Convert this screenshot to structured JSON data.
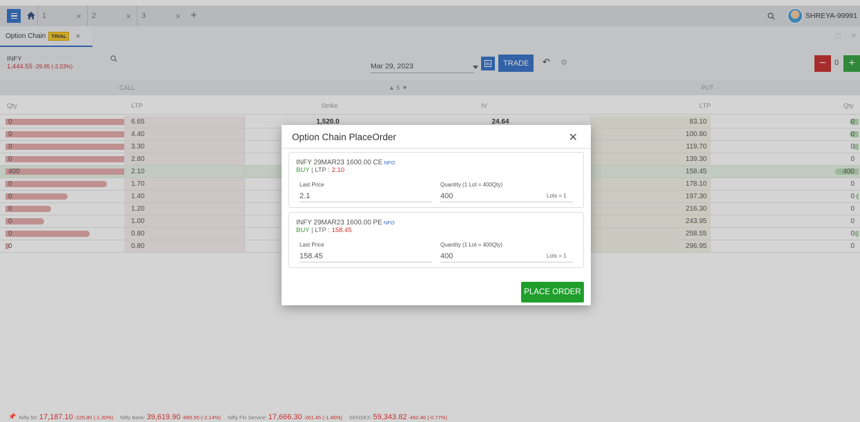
{
  "tabs": [
    {
      "label": "1"
    },
    {
      "label": "2"
    },
    {
      "label": "3"
    }
  ],
  "user": {
    "name": "SHREYA-99991"
  },
  "subtab": {
    "label": "Option Chain",
    "badge": "TRIAL"
  },
  "toolbar": {
    "symbol": "INFY",
    "price": "1,444.55",
    "change": "-29.95 (-2.03%)",
    "expiry": "Mar 29, 2023",
    "trade_label": "TRADE",
    "lots": "0"
  },
  "chain_header": {
    "call": "CALL",
    "put": "PUT",
    "strikes_count": "5"
  },
  "columns": {
    "qty": "Qty",
    "ltp": "LTP",
    "strike": "Strike",
    "iv": "IV",
    "put_ltp": "LTP",
    "put_qty": "Qty"
  },
  "rows": [
    {
      "call_qty": "0",
      "call_ltp": "6.65",
      "strike": "1,520.0",
      "iv": "24.64",
      "put_ltp": "83.10",
      "put_qty": "0",
      "call_bar": 0.94,
      "put_bar": 0.06
    },
    {
      "call_qty": "0",
      "call_ltp": "4.40",
      "strike": "",
      "iv": "",
      "put_ltp": "100.80",
      "put_qty": "0",
      "call_bar": 0.94,
      "put_bar": 0.06
    },
    {
      "call_qty": "0",
      "call_ltp": "3.30",
      "strike": "",
      "iv": "",
      "put_ltp": "119.70",
      "put_qty": "0",
      "call_bar": 0.73,
      "put_bar": 0.04
    },
    {
      "call_qty": "0",
      "call_ltp": "2.80",
      "strike": "",
      "iv": "",
      "put_ltp": "139.30",
      "put_qty": "0",
      "call_bar": 0.66,
      "put_bar": 0
    },
    {
      "call_qty": "400",
      "call_ltp": "2.10",
      "strike": "",
      "iv": "",
      "put_ltp": "158.45",
      "put_qty": "400",
      "call_bar": 1.0,
      "put_bar": 0.16,
      "atm": true
    },
    {
      "call_qty": "0",
      "call_ltp": "1.70",
      "strike": "",
      "iv": "",
      "put_ltp": "178.10",
      "put_qty": "0",
      "call_bar": 0.47,
      "put_bar": 0
    },
    {
      "call_qty": "0",
      "call_ltp": "1.40",
      "strike": "",
      "iv": "",
      "put_ltp": "197.30",
      "put_qty": "0",
      "call_bar": 0.29,
      "put_bar": 0.02
    },
    {
      "call_qty": "0",
      "call_ltp": "1.20",
      "strike": "",
      "iv": "",
      "put_ltp": "216.30",
      "put_qty": "0",
      "call_bar": 0.21,
      "put_bar": 0
    },
    {
      "call_qty": "0",
      "call_ltp": "1.00",
      "strike": "",
      "iv": "",
      "put_ltp": "243.95",
      "put_qty": "0",
      "call_bar": 0.18,
      "put_bar": 0
    },
    {
      "call_qty": "0",
      "call_ltp": "0.80",
      "strike": "",
      "iv": "",
      "put_ltp": "258.55",
      "put_qty": "0",
      "call_bar": 0.39,
      "put_bar": 0.03
    },
    {
      "call_qty": "0",
      "call_ltp": "0.80",
      "strike": "",
      "iv": "",
      "put_ltp": "296.95",
      "put_qty": "0",
      "call_bar": 0.02,
      "put_bar": 0
    }
  ],
  "modal": {
    "title": "Option Chain PlaceOrder",
    "legs": [
      {
        "symbol": "INFY 29MAR23 1600.00 CE",
        "exchange": "NFO",
        "side": "BUY",
        "ltp_label": "LTP :",
        "ltp": "2.10",
        "price_label": "Last Price",
        "price": "2.1",
        "qty_label": "Quantity (1 Lot = 400Qty)",
        "qty": "400",
        "lots": "Lots = 1"
      },
      {
        "symbol": "INFY 29MAR23 1600.00 PE",
        "exchange": "NFO",
        "side": "BUY",
        "ltp_label": "LTP :",
        "ltp": "158.45",
        "price_label": "Last Price",
        "price": "158.45",
        "qty_label": "Quantity (1 Lot = 400Qty)",
        "qty": "400",
        "lots": "Lots = 1"
      }
    ],
    "place_label": "PLACE ORDER"
  },
  "ticker": [
    {
      "name": "Nifty 50:",
      "value": "17,187.10",
      "change": "-225.80 (-1.30%)"
    },
    {
      "name": "Nifty Bank:",
      "value": "39,619.90",
      "change": "-865.55 (-2.14%)"
    },
    {
      "name": "Nifty Fin Service:",
      "value": "17,666.30",
      "change": "-261.45 (-1.46%)"
    },
    {
      "name": "SENSEX:",
      "value": "59,343.82",
      "change": "-462.46 (-0.77%)"
    }
  ]
}
